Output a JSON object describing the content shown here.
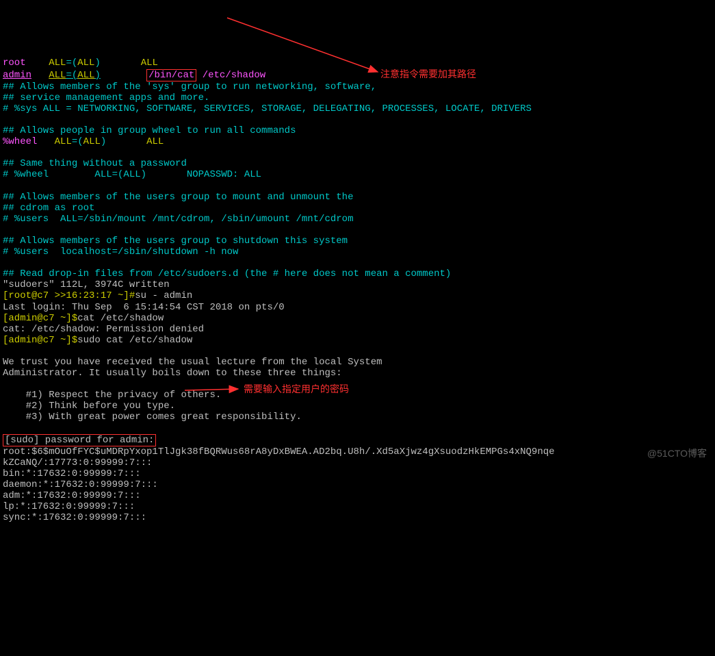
{
  "sudoers": {
    "l1_root": "root",
    "l1_all": "ALL",
    "l1_eq": "=",
    "l1_p1": "(",
    "l1_p2": ")",
    "l1_trail": "ALL",
    "l2_admin": "admin",
    "l2_all": "ALL",
    "l2_p1": "(",
    "l2_p2": ")",
    "l2_cmd": "/bin/cat",
    "l2_arg": " /etc/shadow",
    "c1": "## Allows members of the 'sys' group to run networking, software,",
    "c2": "## service management apps and more.",
    "c3": "# %sys ALL = NETWORKING, SOFTWARE, SERVICES, STORAGE, DELEGATING, PROCESSES, LOCATE, DRIVERS",
    "c4": "## Allows people in group wheel to run all commands",
    "wheel": "%wheel",
    "c5": "## Same thing without a password",
    "c6": "# %wheel        ALL=(ALL)       NOPASSWD: ALL",
    "c7": "## Allows members of the users group to mount and unmount the",
    "c8": "## cdrom as root",
    "c9": "# %users  ALL=/sbin/mount /mnt/cdrom, /sbin/umount /mnt/cdrom",
    "c10": "## Allows members of the users group to shutdown this system",
    "c11": "# %users  localhost=/sbin/shutdown -h now",
    "c12": "## Read drop-in files from /etc/sudoers.d (the # here does not mean a comment)"
  },
  "term": {
    "written": "\"sudoers\" 112L, 3974C written",
    "prompt_root": "[root@c7 >>16:23:17 ~]#",
    "su_cmd": "su - admin",
    "lastlogin": "Last login: Thu Sep  6 15:14:54 CST 2018 on pts/0",
    "prompt_admin": "[admin@c7 ~]$",
    "cat_cmd": "cat /etc/shadow",
    "perm_denied": "cat: /etc/shadow: Permission denied",
    "sudo_cmd": "sudo cat /etc/shadow",
    "trust1": "We trust you have received the usual lecture from the local System",
    "trust2": "Administrator. It usually boils down to these three things:",
    "r1": "    #1) Respect the privacy of others.",
    "r2": "    #2) Think before you type.",
    "r3": "    #3) With great power comes great responsibility.",
    "sudo_pw": "[sudo] password for admin:",
    "shadow1": "root:$6$mOuOfFYC$uMDRpYxop1TlJgk38fBQRWus68rA8yDxBWEA.AD2bq.U8h/.Xd5aXjwz4gXsuodzHkEMPGs4xNQ9nqe",
    "shadow2": "kZCaNQ/:17773:0:99999:7:::",
    "shadow3": "bin:*:17632:0:99999:7:::",
    "shadow4": "daemon:*:17632:0:99999:7:::",
    "shadow5": "adm:*:17632:0:99999:7:::",
    "shadow6": "lp:*:17632:0:99999:7:::",
    "shadow7": "sync:*:17632:0:99999:7:::"
  },
  "annot": {
    "note1": "注意指令需要加其路径",
    "note2": "需要输入指定用户的密码"
  },
  "watermark": "@51CTO博客"
}
